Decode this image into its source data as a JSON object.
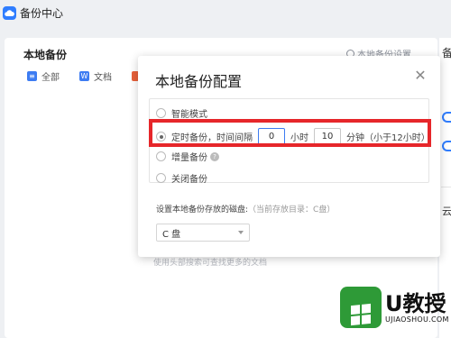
{
  "app": {
    "title": "备份中心"
  },
  "background": {
    "heading": "本地备份",
    "settings_link": "本地备份设置",
    "tabs": [
      {
        "label": "全部",
        "icon": "list-icon"
      },
      {
        "label": "文档",
        "icon": "word-doc-icon"
      }
    ],
    "hint": "使用头部搜索可查找更多的文档",
    "right_edge_title": "备",
    "right_edge_bottom": "云"
  },
  "dialog": {
    "title": "本地备份配置",
    "options": {
      "smart": "智能模式",
      "timed_prefix": "定时备份，时间间隔",
      "hours_value": "0",
      "hours_unit": "小时",
      "minutes_value": "10",
      "minutes_unit": "分钟（小于12小时）",
      "incremental": "增量备份",
      "off": "关闭备份"
    },
    "disk": {
      "label": "设置本地备份存放的磁盘:",
      "current": "（当前存放目录：C盘）",
      "selected": "C 盘"
    },
    "selected_option": "timed"
  },
  "watermark": {
    "brand": "U教授",
    "domain": "UJIAOSHOU.COM"
  },
  "colors": {
    "accent": "#2f7dff",
    "highlight": "#e6262a",
    "brand_green": "#2e9a37"
  }
}
